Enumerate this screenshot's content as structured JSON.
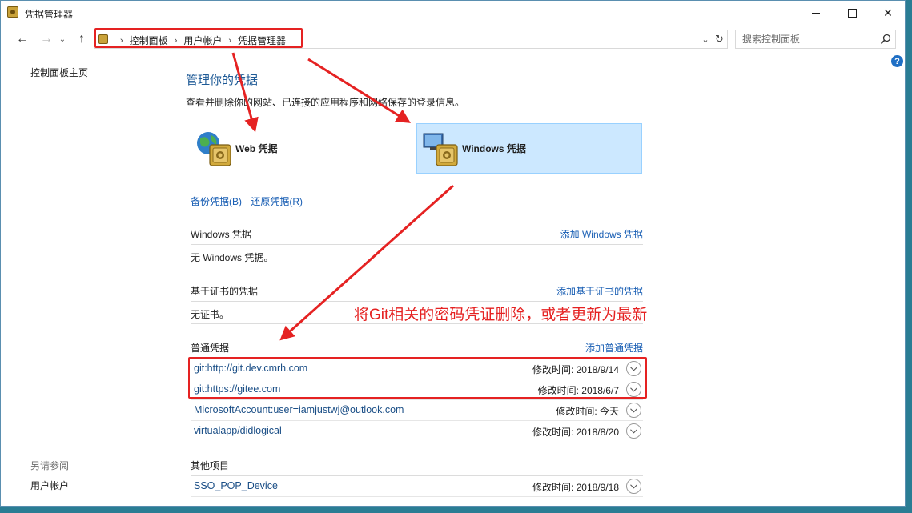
{
  "window": {
    "title": "凭据管理器"
  },
  "breadcrumb": [
    "控制面板",
    "用户帐户",
    "凭据管理器"
  ],
  "search": {
    "placeholder": "搜索控制面板"
  },
  "sidebar": {
    "home": "控制面板主页",
    "see_also_title": "另请参阅",
    "see_also_link": "用户帐户"
  },
  "main": {
    "title": "管理你的凭据",
    "description": "查看并删除你的网站、已连接的应用程序和网络保存的登录信息。",
    "tiles": {
      "web": "Web 凭据",
      "windows": "Windows 凭据"
    },
    "backup_link": "备份凭据(B)",
    "restore_link": "还原凭据(R)"
  },
  "sections": {
    "windows": {
      "title": "Windows 凭据",
      "action": "添加 Windows 凭据",
      "empty": "无 Windows 凭据。"
    },
    "certificate": {
      "title": "基于证书的凭据",
      "action": "添加基于证书的凭据",
      "empty": "无证书。"
    },
    "generic": {
      "title": "普通凭据",
      "action": "添加普通凭据",
      "items": [
        {
          "name": "git:http://git.dev.cmrh.com",
          "modified": "修改时间:  2018/9/14"
        },
        {
          "name": "git:https://gitee.com",
          "modified": "修改时间:  2018/6/7"
        },
        {
          "name": "MicrosoftAccount:user=iamjustwj@outlook.com",
          "modified": "修改时间:  今天"
        },
        {
          "name": "virtualapp/didlogical",
          "modified": "修改时间:  2018/8/20"
        }
      ]
    },
    "other": {
      "title": "其他项目",
      "items": [
        {
          "name": "SSO_POP_Device",
          "modified": "修改时间:  2018/9/18"
        }
      ]
    }
  },
  "annotation": {
    "text": "将Git相关的密码凭证删除，或者更新为最新"
  },
  "colors": {
    "link": "#1a5fb4",
    "annotation": "#e52222",
    "selected_tile": "#cce8ff"
  }
}
